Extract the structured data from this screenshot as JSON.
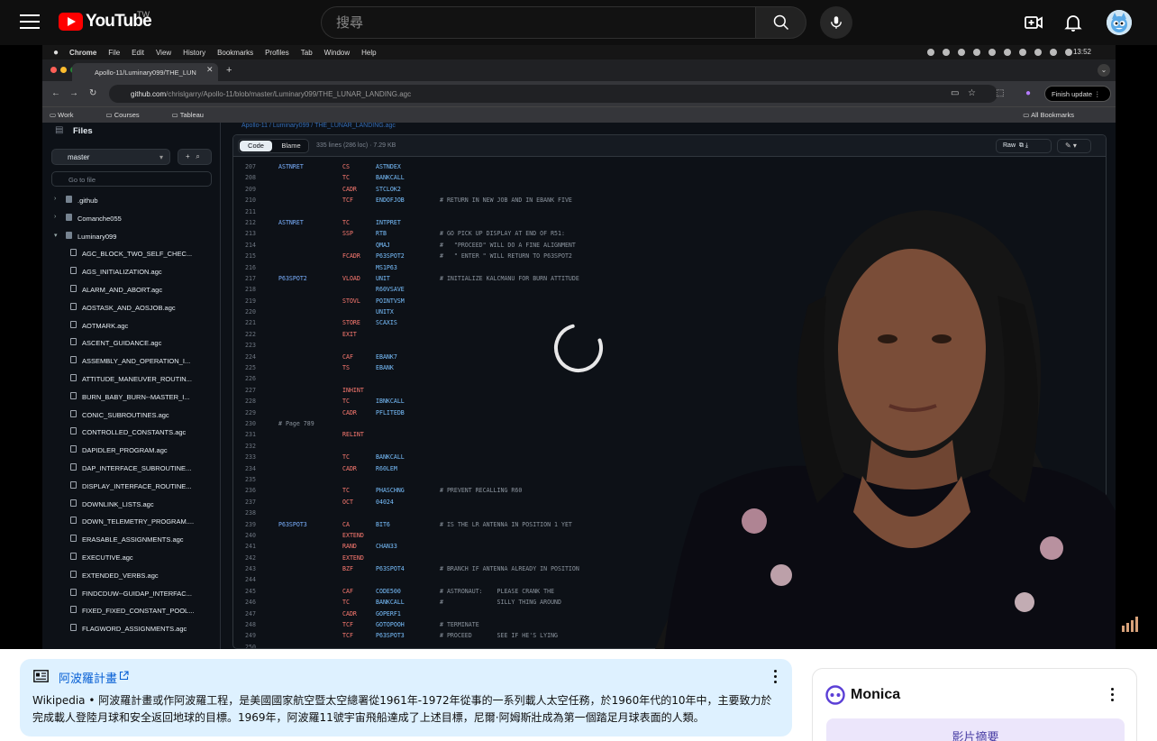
{
  "youtube": {
    "brand": "YouTube",
    "region": "TW",
    "search_placeholder": "搜尋"
  },
  "video": {
    "mac_menu": [
      "Chrome",
      "File",
      "Edit",
      "View",
      "History",
      "Bookmarks",
      "Profiles",
      "Tab",
      "Window",
      "Help"
    ],
    "mac_time": "13:52",
    "tab_title": "Apollo-11/Luminary099/THE_LUN",
    "url_host": "github.com",
    "url_path": "/chrislgarry/Apollo-11/blob/master/Luminary099/THE_LUNAR_LANDING.agc",
    "finish_update": "Finish update",
    "bookmarks": [
      "Work",
      "Courses",
      "Tableau"
    ],
    "all_bookmarks": "All Bookmarks",
    "breadcrumb": "Apollo-11 / Luminary099 / THE_LUNAR_LANDING.agc",
    "files_title": "Files",
    "branch": "master",
    "go_to_file": "Go to file",
    "tree": [
      {
        "name": ".github",
        "type": "folder",
        "depth": 0
      },
      {
        "name": "Comanche055",
        "type": "folder",
        "depth": 0
      },
      {
        "name": "Luminary099",
        "type": "folder-open",
        "depth": 0
      },
      {
        "name": "AGC_BLOCK_TWO_SELF_CHEC...",
        "type": "file",
        "depth": 1
      },
      {
        "name": "AGS_INITIALIZATION.agc",
        "type": "file",
        "depth": 1
      },
      {
        "name": "ALARM_AND_ABORT.agc",
        "type": "file",
        "depth": 1
      },
      {
        "name": "AOSTASK_AND_AOSJOB.agc",
        "type": "file",
        "depth": 1
      },
      {
        "name": "AOTMARK.agc",
        "type": "file",
        "depth": 1
      },
      {
        "name": "ASCENT_GUIDANCE.agc",
        "type": "file",
        "depth": 1
      },
      {
        "name": "ASSEMBLY_AND_OPERATION_I...",
        "type": "file",
        "depth": 1
      },
      {
        "name": "ATTITUDE_MANEUVER_ROUTIN...",
        "type": "file",
        "depth": 1
      },
      {
        "name": "BURN_BABY_BURN--MASTER_I...",
        "type": "file",
        "depth": 1
      },
      {
        "name": "CONIC_SUBROUTINES.agc",
        "type": "file",
        "depth": 1
      },
      {
        "name": "CONTROLLED_CONSTANTS.agc",
        "type": "file",
        "depth": 1
      },
      {
        "name": "DAPIDLER_PROGRAM.agc",
        "type": "file",
        "depth": 1
      },
      {
        "name": "DAP_INTERFACE_SUBROUTINE...",
        "type": "file",
        "depth": 1
      },
      {
        "name": "DISPLAY_INTERFACE_ROUTINE...",
        "type": "file",
        "depth": 1
      },
      {
        "name": "DOWNLINK_LISTS.agc",
        "type": "file",
        "depth": 1
      },
      {
        "name": "DOWN_TELEMETRY_PROGRAM....",
        "type": "file",
        "depth": 1
      },
      {
        "name": "ERASABLE_ASSIGNMENTS.agc",
        "type": "file",
        "depth": 1
      },
      {
        "name": "EXECUTIVE.agc",
        "type": "file",
        "depth": 1
      },
      {
        "name": "EXTENDED_VERBS.agc",
        "type": "file",
        "depth": 1
      },
      {
        "name": "FINDCDUW--GUIDAP_INTERFAC...",
        "type": "file",
        "depth": 1
      },
      {
        "name": "FIXED_FIXED_CONSTANT_POOL...",
        "type": "file",
        "depth": 1
      },
      {
        "name": "FLAGWORD_ASSIGNMENTS.agc",
        "type": "file",
        "depth": 1
      }
    ],
    "code_tab": "Code",
    "blame_tab": "Blame",
    "file_meta": "335 lines (286 loc) · 7.29 KB",
    "raw_label": "Raw",
    "code": [
      {
        "ln": "207",
        "lab": "ASTNRET",
        "op": "CS",
        "arg": "ASTNDEX",
        "cmt": ""
      },
      {
        "ln": "208",
        "lab": "",
        "op": "TC",
        "arg": "BANKCALL",
        "cmt": ""
      },
      {
        "ln": "209",
        "lab": "",
        "op": "CADR",
        "arg": "STCLOK2",
        "cmt": ""
      },
      {
        "ln": "210",
        "lab": "",
        "op": "TCF",
        "arg": "ENDOFJOB",
        "cmt": "# RETURN IN NEW JOB AND IN EBANK FIVE"
      },
      {
        "ln": "211",
        "lab": "",
        "op": "",
        "arg": "",
        "cmt": ""
      },
      {
        "ln": "212",
        "lab": "ASTNRET",
        "op": "TC",
        "arg": "INTPRET",
        "cmt": ""
      },
      {
        "ln": "213",
        "lab": "",
        "op": "SSP",
        "arg": "RTB",
        "cmt": "# GO PICK UP DISPLAY AT END OF R51:"
      },
      {
        "ln": "214",
        "lab": "",
        "op": "",
        "arg": "QMAJ",
        "cmt": "#   \"PROCEED\" WILL DO A FINE ALIGNMENT"
      },
      {
        "ln": "215",
        "lab": "",
        "op": "FCADR",
        "arg": "P63SPOT2",
        "cmt": "#   \" ENTER \" WILL RETURN TO P63SPOT2"
      },
      {
        "ln": "216",
        "lab": "",
        "op": "",
        "arg": "MS1P63",
        "cmt": ""
      },
      {
        "ln": "217",
        "lab": "P63SPOT2",
        "op": "VLOAD",
        "arg": "UNIT",
        "cmt": "# INITIALIZE KALCMANU FOR BURN ATTITUDE"
      },
      {
        "ln": "218",
        "lab": "",
        "op": "",
        "arg": "R60VSAVE",
        "cmt": ""
      },
      {
        "ln": "219",
        "lab": "",
        "op": "STOVL",
        "arg": "POINTVSM",
        "cmt": ""
      },
      {
        "ln": "220",
        "lab": "",
        "op": "",
        "arg": "UNITX",
        "cmt": ""
      },
      {
        "ln": "221",
        "lab": "",
        "op": "STORE",
        "arg": "SCAXIS",
        "cmt": ""
      },
      {
        "ln": "222",
        "lab": "",
        "op": "EXIT",
        "arg": "",
        "cmt": ""
      },
      {
        "ln": "223",
        "lab": "",
        "op": "",
        "arg": "",
        "cmt": ""
      },
      {
        "ln": "224",
        "lab": "",
        "op": "CAF",
        "arg": "EBANK7",
        "cmt": ""
      },
      {
        "ln": "225",
        "lab": "",
        "op": "TS",
        "arg": "EBANK",
        "cmt": ""
      },
      {
        "ln": "226",
        "lab": "",
        "op": "",
        "arg": "",
        "cmt": ""
      },
      {
        "ln": "227",
        "lab": "",
        "op": "INHINT",
        "arg": "",
        "cmt": ""
      },
      {
        "ln": "228",
        "lab": "",
        "op": "TC",
        "arg": "IBNKCALL",
        "cmt": ""
      },
      {
        "ln": "229",
        "lab": "",
        "op": "CADR",
        "arg": "PFLITEDB",
        "cmt": ""
      },
      {
        "ln": "230",
        "lab": "# Page 789",
        "op": "",
        "arg": "",
        "cmt": ""
      },
      {
        "ln": "231",
        "lab": "",
        "op": "RELINT",
        "arg": "",
        "cmt": ""
      },
      {
        "ln": "232",
        "lab": "",
        "op": "",
        "arg": "",
        "cmt": ""
      },
      {
        "ln": "233",
        "lab": "",
        "op": "TC",
        "arg": "BANKCALL",
        "cmt": ""
      },
      {
        "ln": "234",
        "lab": "",
        "op": "CADR",
        "arg": "R60LEM",
        "cmt": ""
      },
      {
        "ln": "235",
        "lab": "",
        "op": "",
        "arg": "",
        "cmt": ""
      },
      {
        "ln": "236",
        "lab": "",
        "op": "TC",
        "arg": "PHASCHNG",
        "cmt": "# PREVENT RECALLING R60"
      },
      {
        "ln": "237",
        "lab": "",
        "op": "OCT",
        "arg": "04024",
        "cmt": ""
      },
      {
        "ln": "238",
        "lab": "",
        "op": "",
        "arg": "",
        "cmt": ""
      },
      {
        "ln": "239",
        "lab": "P63SPOT3",
        "op": "CA",
        "arg": "BIT6",
        "cmt": "# IS THE LR ANTENNA IN POSITION 1 YET"
      },
      {
        "ln": "240",
        "lab": "",
        "op": "EXTEND",
        "arg": "",
        "cmt": ""
      },
      {
        "ln": "241",
        "lab": "",
        "op": "RAND",
        "arg": "CHAN33",
        "cmt": ""
      },
      {
        "ln": "242",
        "lab": "",
        "op": "EXTEND",
        "arg": "",
        "cmt": ""
      },
      {
        "ln": "243",
        "lab": "",
        "op": "BZF",
        "arg": "P63SPOT4",
        "cmt": "# BRANCH IF ANTENNA ALREADY IN POSITION"
      },
      {
        "ln": "244",
        "lab": "",
        "op": "",
        "arg": "",
        "cmt": ""
      },
      {
        "ln": "245",
        "lab": "",
        "op": "CAF",
        "arg": "CODE500",
        "cmt": "# ASTRONAUT:    PLEASE CRANK THE"
      },
      {
        "ln": "246",
        "lab": "",
        "op": "TC",
        "arg": "BANKCALL",
        "cmt": "#               SILLY THING AROUND"
      },
      {
        "ln": "247",
        "lab": "",
        "op": "CADR",
        "arg": "GOPERF1",
        "cmt": ""
      },
      {
        "ln": "248",
        "lab": "",
        "op": "TCF",
        "arg": "GOTOPOOH",
        "cmt": "# TERMINATE"
      },
      {
        "ln": "249",
        "lab": "",
        "op": "TCF",
        "arg": "P63SPOT3",
        "cmt": "# PROCEED       SEE IF HE'S LYING"
      },
      {
        "ln": "250",
        "lab": "",
        "op": "",
        "arg": "",
        "cmt": ""
      }
    ]
  },
  "wiki": {
    "title": "阿波羅計畫",
    "source": "Wikipedia",
    "separator": " • ",
    "text": "阿波羅計畫或作阿波羅工程，是美國國家航空暨太空總署從1961年-1972年從事的一系列載人太空任務，於1960年代的10年中，主要致力於完成載人登陸月球和安全返回地球的目標。1969年，阿波羅11號宇宙飛船達成了上述目標，尼爾·阿姆斯壯成為第一個踏足月球表面的人類。"
  },
  "monica": {
    "name": "Monica",
    "summary_button": "影片摘要"
  },
  "colors": {
    "youtube_red": "#ff0000",
    "wiki_card_bg": "#def1ff",
    "link_blue": "#065fd4",
    "monica_accent": "#ece6fb"
  }
}
